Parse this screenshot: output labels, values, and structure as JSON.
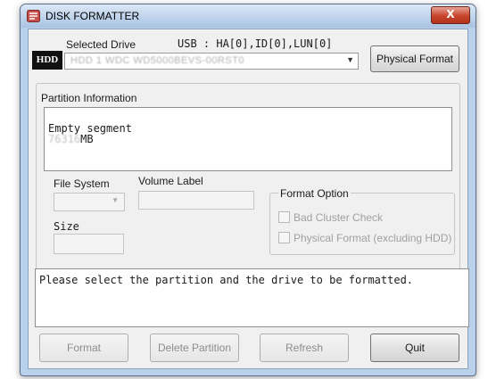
{
  "window": {
    "title": "DISK FORMATTER",
    "close_label": "X"
  },
  "drive": {
    "badge": "HDD",
    "selected_label": "Selected Drive",
    "id_text": "USB : HA[0],ID[0],LUN[0]",
    "select_value": "HDD 1 WDC WD5000BEVS-00RST0",
    "physical_format_label": "Physical Format"
  },
  "partition": {
    "group_label": "Partition Information",
    "line1": "Empty segment",
    "size_value": "76316",
    "size_unit": "MB"
  },
  "fields": {
    "file_system_label": "File System",
    "volume_label_label": "Volume Label",
    "size_label": "Size"
  },
  "format_option": {
    "group_label": "Format Option",
    "bad_cluster_label": "Bad Cluster Check",
    "physical_format_label": "Physical Format (excluding HDD)"
  },
  "status": {
    "message": "Please select the partition and the drive to be formatted."
  },
  "buttons": {
    "format": "Format",
    "delete_partition": "Delete Partition",
    "refresh": "Refresh",
    "quit": "Quit"
  },
  "colors": {
    "title_bar": "#a9c3e2",
    "close_button": "#c7452c",
    "disabled_text": "#8d8d8d"
  }
}
